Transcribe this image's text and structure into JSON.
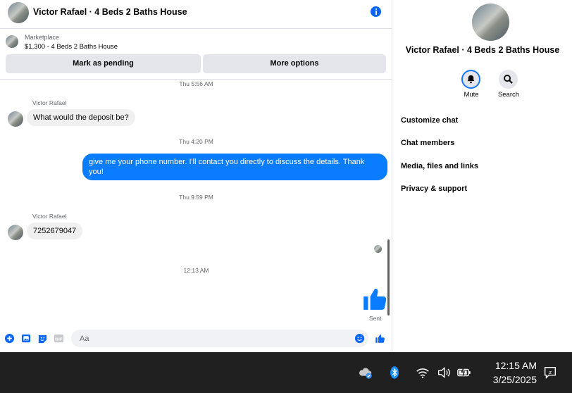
{
  "header": {
    "title": "Victor Rafael · 4 Beds 2 Baths House",
    "info_icon": "info-icon"
  },
  "marketplace": {
    "label": "Marketplace",
    "listing": "$1,300 - 4 Beds 2 Baths House",
    "mark_pending_label": "Mark as pending",
    "more_options_label": "More options"
  },
  "messages": {
    "ts1": "Thu 5:56 AM",
    "msg1_sender": "Victor Rafael",
    "msg1_text": "What would the deposit be?",
    "ts2": "Thu 4:20 PM",
    "msg2_text": "give me your phone number. I'll contact you directly to discuss the details. Thank you!",
    "ts3": "Thu 9:59 PM",
    "msg3_sender": "Victor Rafael",
    "msg3_text": "7252679047",
    "ts4": "12:13 AM",
    "sent_label": "Sent"
  },
  "composer": {
    "placeholder": "Aa",
    "icons": [
      "plus-icon",
      "photo-icon",
      "sticker-icon",
      "gif-icon",
      "emoji-icon",
      "like-icon"
    ]
  },
  "right_panel": {
    "title": "Victor Rafael · 4 Beds 2 Baths House",
    "mute_label": "Mute",
    "search_label": "Search",
    "menu": [
      "Customize chat",
      "Chat members",
      "Media, files and links",
      "Privacy & support"
    ]
  },
  "taskbar": {
    "time": "12:15 AM",
    "date": "3/25/2025",
    "icons": [
      "onedrive-icon",
      "bluetooth-icon",
      "wifi-icon",
      "volume-icon",
      "battery-icon",
      "notification-icon"
    ]
  },
  "colors": {
    "accent": "#0866ff",
    "outgoing_bubble": "#0a7cff",
    "incoming_bubble": "#f0f0f0",
    "taskbar": "#202020"
  }
}
